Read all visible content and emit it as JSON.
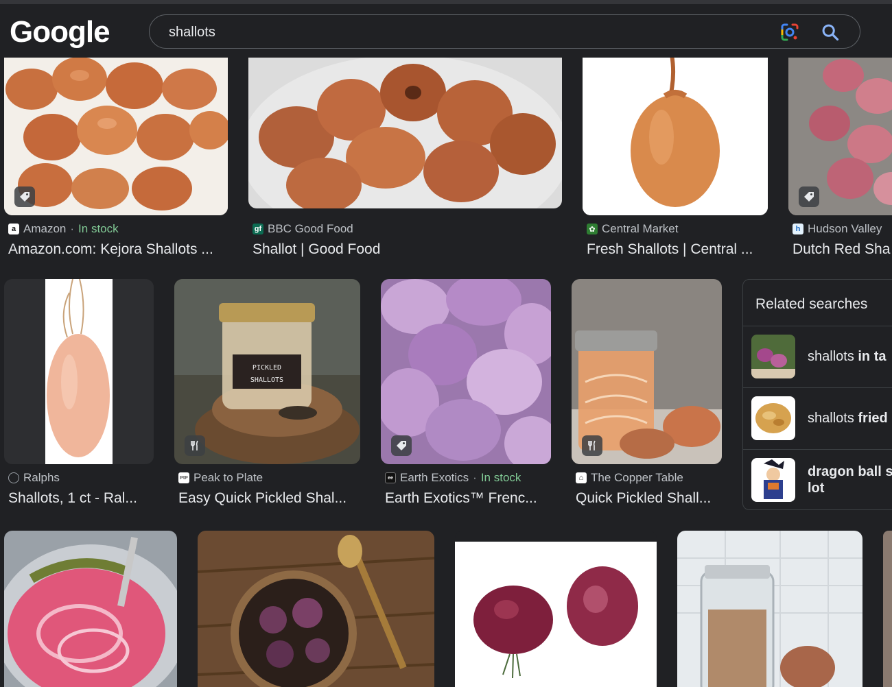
{
  "header": {
    "logo": "Google",
    "query": "shallots"
  },
  "rows": [
    {
      "cards": [
        {
          "source": "Amazon",
          "stock": "In stock",
          "title": "Amazon.com: Kejora Shallots ..."
        },
        {
          "source": "BBC Good Food",
          "title": "Shallot | Good Food"
        },
        {
          "source": "Central Market",
          "title": "Fresh Shallots | Central ..."
        },
        {
          "source": "Hudson Valley",
          "title": "Dutch Red Sha"
        }
      ]
    },
    {
      "cards": [
        {
          "source": "Ralphs",
          "title": "Shallots, 1 ct - Ral..."
        },
        {
          "source": "Peak to Plate",
          "title": "Easy Quick Pickled Shal..."
        },
        {
          "source": "Earth Exotics",
          "stock": "In stock",
          "title": "Earth Exotics™ Frenc..."
        },
        {
          "source": "The Copper Table",
          "title": "Quick Pickled Shall..."
        }
      ]
    }
  ],
  "related": {
    "heading": "Related searches",
    "items": [
      {
        "plain": "shallots ",
        "bold": "in ta"
      },
      {
        "plain": "shallots ",
        "bold": "fried"
      },
      {
        "plain": "",
        "bold": "dragon ball s",
        "line2": "lot"
      }
    ]
  },
  "badges": {
    "tag": "tag-icon",
    "recipe": "recipe-icon"
  }
}
